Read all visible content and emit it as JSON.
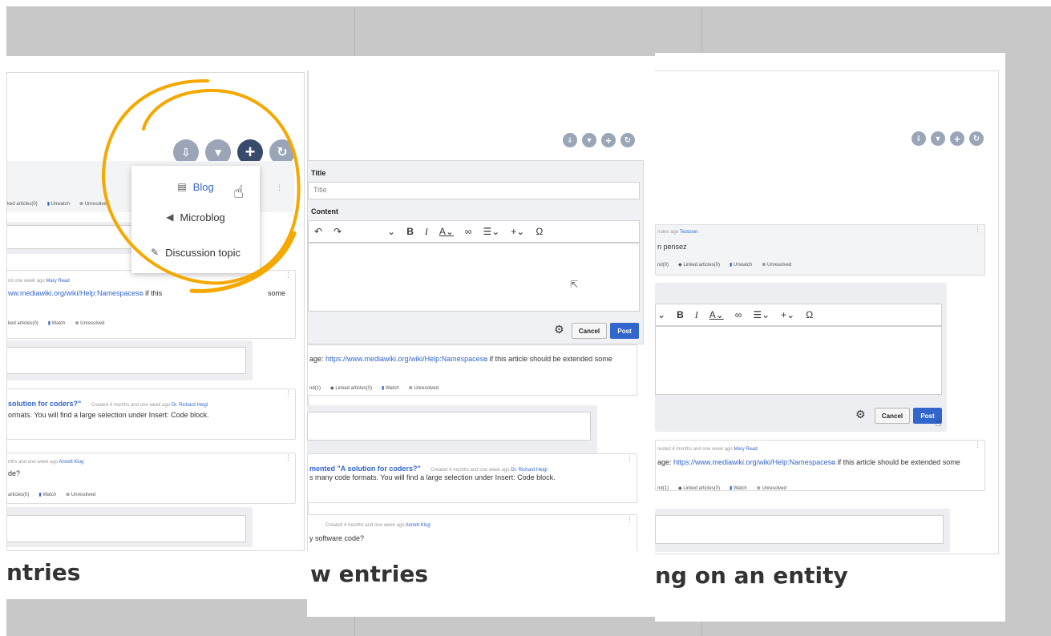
{
  "accent_color": "#f5a800",
  "link_color": "#3366cc",
  "post_button_color": "#3366cc",
  "slide1": {
    "caption": "ntries",
    "menu": {
      "blog": "Blog",
      "microblog": "Microblog",
      "discussion": "Discussion topic"
    },
    "topbar_actions": {
      "linked": "ked articles(0)",
      "unwatch": "Unwatch",
      "unresolved": "Unresolved"
    },
    "card1": {
      "meta_prefix": "nd one week ago",
      "author": "Mary Read",
      "link": "ww.mediawiki.org/wiki/Help:Namespaces",
      "text_after": " if this",
      "text_tail": "some",
      "linked": "ked articles(0)",
      "watch": "Watch",
      "unresolved": "Unresolved"
    },
    "card2": {
      "title": "solution for coders?\"",
      "meta_prefix": "Created 4 months and one week ago",
      "author": "Dr. Richard Heigl",
      "text": "ormats. You will find a large selection under Insert: Code block."
    },
    "card3": {
      "meta_prefix": "nths and one week ago",
      "author": "Annett Klug",
      "text": "de?",
      "linked": "articles(0)",
      "watch": "Watch",
      "unresolved": "Unresolved"
    }
  },
  "slide2": {
    "caption": "w entries",
    "title_label": "Title",
    "title_placeholder": "Title",
    "content_label": "Content",
    "cancel": "Cancel",
    "post": "Post",
    "card1": {
      "text_prefix": "age: ",
      "link": "https://www.mediawiki.org/wiki/Help:Namespaces",
      "text_after": " if this article should be extended some",
      "linked_prefix": "nd(1)",
      "linked": "Linked articles(0)",
      "watch": "Watch",
      "unresolved": "Unresolved"
    },
    "card2": {
      "title": "mented \"A solution for coders?\"",
      "meta_prefix": "Created 4 months and one week ago",
      "author": "Dr. Richard Heigl",
      "text": "s many code formats. You will find a large selection under Insert: Code block."
    },
    "card3": {
      "meta_prefix": "Created 4 months and one week ago",
      "author": "Annett Klug",
      "text": "y software code?"
    }
  },
  "slide3": {
    "caption": "ng on an entity",
    "card1": {
      "meta_prefix": "nutes ago",
      "author": "Testuser",
      "text": "n pensez",
      "linked_prefix": "nd(0)",
      "linked": "Linked articles(0)",
      "unwatch": "Unwatch",
      "unresolved": "Unresolved"
    },
    "cancel": "Cancel",
    "post": "Post",
    "card2": {
      "meta_prefix": "rested 4 months and one week ago",
      "author": "Mary Read",
      "text_prefix": "age: ",
      "link": "https://www.mediawiki.org/wiki/Help:Namespaces",
      "text_after": " if this article should be extended some",
      "linked_prefix": "nd(1)",
      "linked": "Linked articles(0)",
      "watch": "Watch",
      "unresolved": "Unresolved"
    }
  }
}
